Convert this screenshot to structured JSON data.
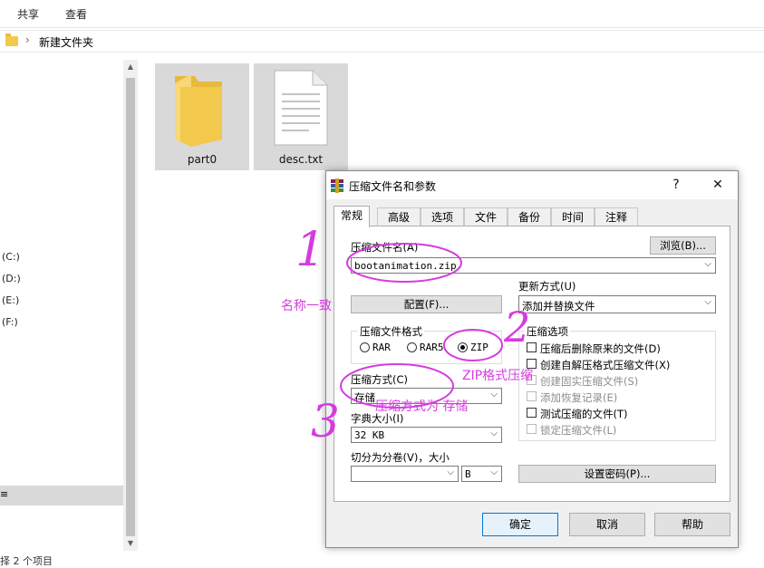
{
  "explorer": {
    "ribbon_tabs": [
      "共享",
      "查看"
    ],
    "breadcrumb_sep": "›",
    "breadcrumb_folder": "新建文件夹",
    "drives": [
      "(C:)",
      "(D:)",
      "(E:)",
      "(F:)"
    ],
    "selected_nav_fragment": "≡",
    "status_text": "择 2 个项目",
    "files": [
      {
        "name": "part0",
        "icon": "folder-icon"
      },
      {
        "name": "desc.txt",
        "icon": "text-file-icon"
      }
    ]
  },
  "dialog": {
    "title": "压缩文件名和参数",
    "help_glyph": "?",
    "close_glyph": "✕",
    "tabs": [
      "常规",
      "高级",
      "选项",
      "文件",
      "备份",
      "时间",
      "注释"
    ],
    "archive_name_label": "压缩文件名(A)",
    "browse_button": "浏览(B)...",
    "archive_name_value": "bootanimation.zip",
    "update_mode_label": "更新方式(U)",
    "update_mode_value": "添加并替换文件",
    "profiles_button": "配置(F)...",
    "format_group_label": "压缩文件格式",
    "formats": [
      {
        "label": "RAR",
        "selected": false
      },
      {
        "label": "RAR5",
        "selected": false
      },
      {
        "label": "ZIP",
        "selected": true
      }
    ],
    "options_group_label": "压缩选项",
    "options": [
      {
        "label": "压缩后删除原来的文件(D)",
        "checked": false,
        "enabled": true
      },
      {
        "label": "创建自解压格式压缩文件(X)",
        "checked": false,
        "enabled": true
      },
      {
        "label": "创建固实压缩文件(S)",
        "checked": false,
        "enabled": false
      },
      {
        "label": "添加恢复记录(E)",
        "checked": false,
        "enabled": false
      },
      {
        "label": "测试压缩的文件(T)",
        "checked": false,
        "enabled": true
      },
      {
        "label": "锁定压缩文件(L)",
        "checked": false,
        "enabled": false
      }
    ],
    "method_label": "压缩方式(C)",
    "method_value": "存储",
    "dict_label": "字典大小(I)",
    "dict_value": "32 KB",
    "split_label": "切分为分卷(V)，大小",
    "split_value": "",
    "split_unit": "B",
    "password_button": "设置密码(P)...",
    "ok_button": "确定",
    "cancel_button": "取消",
    "help_button": "帮助"
  },
  "annotations": {
    "num1": "1",
    "num2": "2",
    "num3": "3",
    "note1": "名称一致",
    "note2": "ZIP格式压缩",
    "note3": "压缩方式为 存储",
    "color": "#d63be0"
  }
}
